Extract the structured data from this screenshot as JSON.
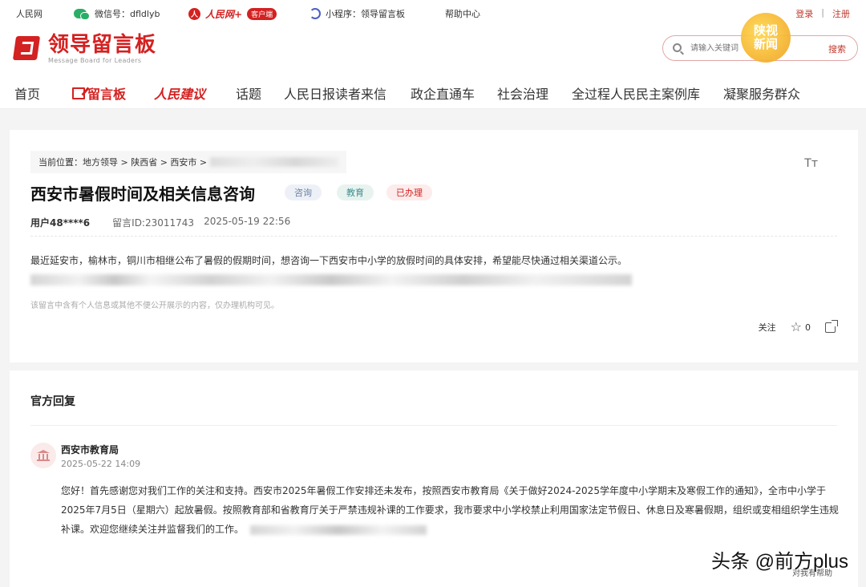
{
  "topbar": {
    "site": "人民网",
    "wechat": "微信号：dfldlyb",
    "rmw_logo": "人民网+",
    "rmw_badge": "客户端",
    "mini_program": "小程序：领导留言板",
    "help": "帮助中心",
    "login": "登录",
    "register": "注册"
  },
  "header": {
    "logo_cn": "领导留言板",
    "logo_en": "Message Board for Leaders",
    "search_placeholder": "请输入关键词",
    "search_button": "搜索",
    "badge_text": "陕视新闻"
  },
  "nav": {
    "items": [
      "首页",
      "留言板",
      "人民建议",
      "话题",
      "人民日报读者来信",
      "政企直通车",
      "社会治理",
      "全过程人民民主案例库",
      "凝聚服务群众"
    ]
  },
  "question": {
    "breadcrumb": "当前位置：地方领导 > 陕西省 > 西安市 >",
    "title": "西安市暑假时间及相关信息咨询",
    "tags": [
      "咨询",
      "教育",
      "已办理"
    ],
    "user": "用户48****6",
    "message_id": "留言ID:23011743",
    "time": "2025-05-19 22:56",
    "body": "最近延安市，榆林市，铜川市相继公布了暑假的假期时间，想咨询一下西安市中小学的放假时间的具体安排，希望能尽快通过相关渠道公示。",
    "notice": "该留言中含有个人信息或其他不便公开展示的内容，仅办理机构可见。",
    "follow": "关注",
    "like_count": "0"
  },
  "reply": {
    "heading": "官方回复",
    "org": "西安市教育局",
    "date": "2025-05-22 14:09",
    "body": "您好！首先感谢您对我们工作的关注和支持。西安市2025年暑假工作安排还未发布，按照西安市教育局《关于做好2024-2025学年度中小学期末及寒假工作的通知》，全市中小学于2025年7月5日（星期六）起放暑假。按照教育部和省教育厅关于严禁违规补课的工作要求，我市要求中小学校禁止利用国家法定节假日、休息日及寒暑假期，组织或变相组织学生违规补课。欢迎您继续关注并监督我们的工作。",
    "help_text": "对我有帮助"
  },
  "watermark": "头条 @前方plus"
}
